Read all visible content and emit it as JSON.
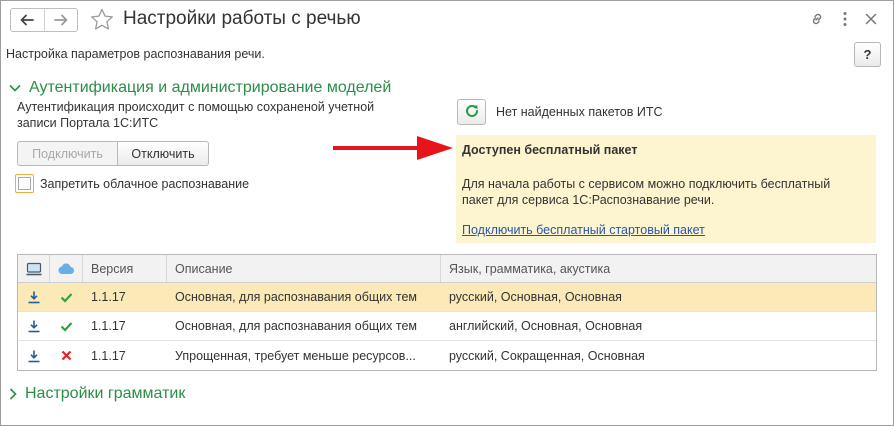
{
  "window": {
    "title": "Настройки работы с речью",
    "subtitle": "Настройка параметров распознавания речи.",
    "help_label": "?"
  },
  "auth_section": {
    "title": "Аутентификация и администрирование моделей",
    "text": "Аутентификация происходит с помощью сохраненой учетной записи Портала 1С:ИТС",
    "connect_label": "Подключить",
    "disconnect_label": "Отключить",
    "checkbox_label": "Запретить облачное распознавание",
    "checkbox_checked": false
  },
  "its": {
    "status": "Нет найденных пакетов ИТС"
  },
  "info_panel": {
    "title": "Доступен бесплатный пакет",
    "body": "Для начала работы с сервисом можно подключить бесплатный пакет для сервиса 1С:Распознавание речи.",
    "link": "Подключить бесплатный стартовый пакет",
    "background": "#fdf5d0"
  },
  "table": {
    "headers": {
      "local_icon": "computer-icon",
      "cloud_icon": "cloud-icon",
      "version": "Версия",
      "description": "Описание",
      "language": "Язык, грамматика, акустика"
    },
    "rows": [
      {
        "local_icon": "download-icon",
        "cloud_icon": "check-icon",
        "version": "1.1.17",
        "description": "Основная, для распознавания общих тем",
        "language": "русский, Основная, Основная",
        "selected": true
      },
      {
        "local_icon": "download-icon",
        "cloud_icon": "check-icon",
        "version": "1.1.17",
        "description": "Основная, для распознавания общих тем",
        "language": "английский, Основная, Основная",
        "selected": false
      },
      {
        "local_icon": "download-icon",
        "cloud_icon": "cross-icon",
        "version": "1.1.17",
        "description": "Упрощенная, требует меньше ресурсов...",
        "language": "русский, Сокращенная, Основная",
        "selected": false
      }
    ]
  },
  "grammar_section": {
    "title": "Настройки грамматик"
  },
  "colors": {
    "accent_green": "#2a8f46",
    "link_blue": "#2a56a7",
    "selection": "#fbe9b7",
    "arrow_red": "#e8141b"
  }
}
